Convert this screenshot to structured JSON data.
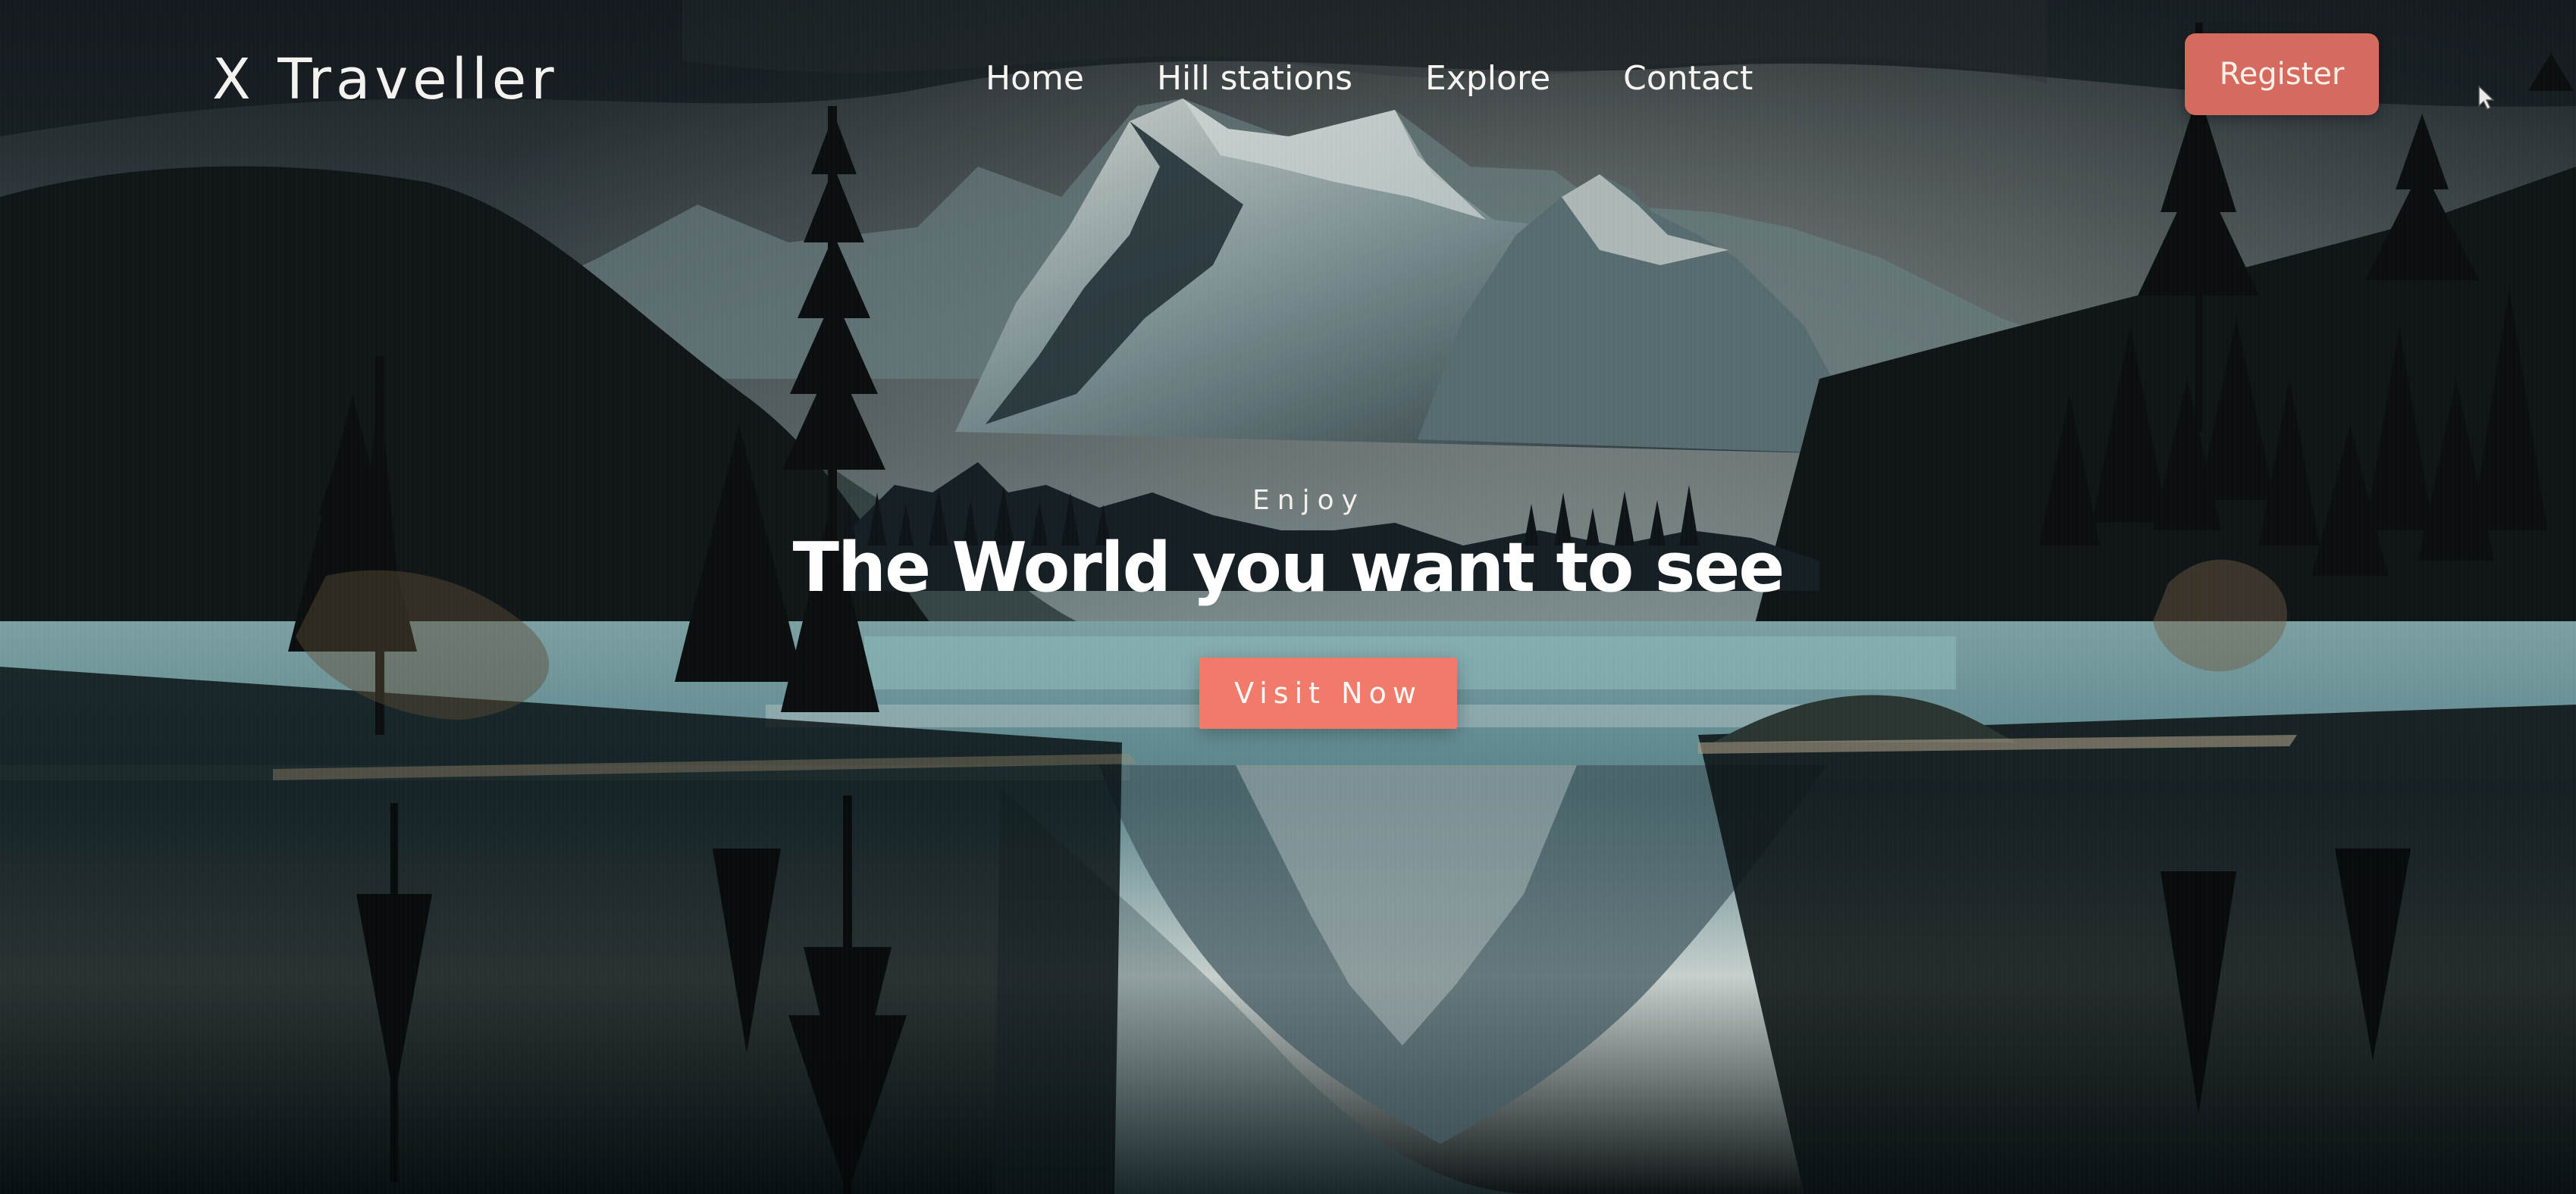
{
  "brand": {
    "name": "X Traveller"
  },
  "nav": {
    "items": [
      {
        "label": "Home"
      },
      {
        "label": "Hill stations"
      },
      {
        "label": "Explore"
      },
      {
        "label": "Contact"
      }
    ],
    "register_label": "Register"
  },
  "hero": {
    "eyebrow": "Enjoy",
    "headline": "The World you want to see",
    "cta_label": "Visit Now",
    "background_icon": "mountain-lake-landscape",
    "colors": {
      "accent": "#F07B6A",
      "register_button": "#D56A5E",
      "text": "#FFFFFF"
    }
  }
}
